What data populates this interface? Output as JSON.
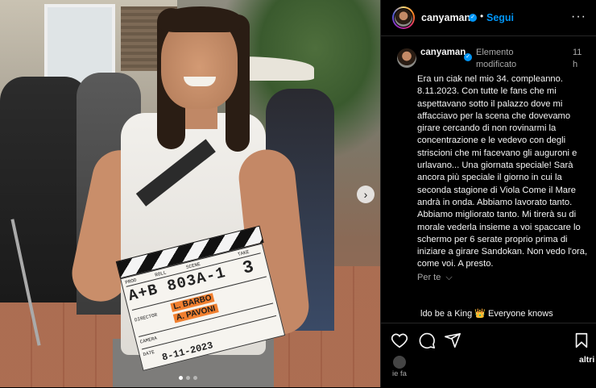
{
  "header": {
    "username": "canyaman",
    "follow_label": "Segui",
    "more_label": "···"
  },
  "comment": {
    "username": "canyaman",
    "edited_label": "Elemento modificato",
    "time": "11 h",
    "text": "Era un ciak nel mio 34. compleanno. 8.11.2023. Con tutte le fans che mi aspettavano sotto il palazzo dove mi affacciavo per la scena che dovevamo girare cercando di non rovinarmi la concentrazione e le vedevo con degli striscioni che mi facevano gli auguroni e urlavano... Una giornata speciale! Sarà ancora più speciale il giorno in cui la seconda stagione di Viola Come il Mare andrà in onda. Abbiamo lavorato tanto. Abbiamo migliorato tanto. Mi tirerà su di morale vederla insieme a voi spaccare lo schermo per 6 serate proprio prima di iniziare a girare Sandokan. Non vedo l'ora, come voi. A presto.",
    "translate_label": "Per te",
    "song_label": "ldo be a King 👑 Everyone knows"
  },
  "likes": {
    "text": "altri",
    "small": "ie fa"
  },
  "clapperboard": {
    "scene": "A+B 803A-1",
    "take": "3",
    "roll_label": "ROLL",
    "scene_label": "SCENE",
    "take_label": "TAKE",
    "prod_label": "PROD",
    "director_label": "DIRECTOR",
    "camera_label": "CAMERA",
    "date_label": "DATE",
    "director_value_1": "L. BARBO",
    "director_value_2": "A. PAVONI",
    "date_value": "8-11-2023"
  },
  "carousel": {
    "next_label": "›",
    "slides": 3,
    "active_slide": 1
  },
  "colors": {
    "accent": "#0095f6",
    "background": "#000000",
    "muted": "#a8a8a8"
  }
}
